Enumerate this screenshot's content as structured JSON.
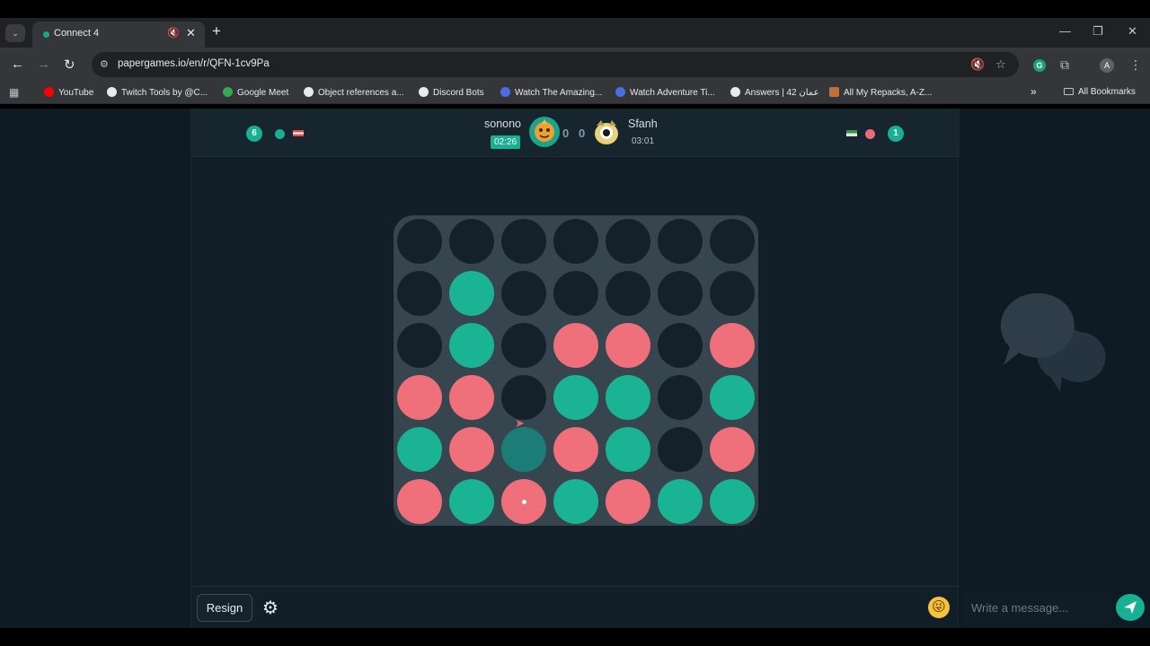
{
  "browser": {
    "tab_title": "Connect 4",
    "new_tab_glyph": "+",
    "tab_close_glyph": "✕",
    "tab_mute_glyph": "🔇",
    "url": "papergames.io/en/r/QFN-1cv9Pa",
    "back_glyph": "←",
    "forward_glyph": "→",
    "reload_glyph": "↻",
    "site_info_glyph": "⚙",
    "star_glyph": "☆",
    "extensions_glyph": "⧉",
    "menu_glyph": "⋮",
    "profile_initial": "A",
    "ext_g_letter": "G",
    "window_minimize": "—",
    "window_restore": "❐",
    "window_close": "✕",
    "tab_list_glyph": "⌄",
    "bookmarks": [
      {
        "label": "YouTube",
        "color": "#ff0000"
      },
      {
        "label": "Twitch Tools by @C...",
        "color": "#e8eaed"
      },
      {
        "label": "Google Meet",
        "color": "#34a853"
      },
      {
        "label": "Object references a...",
        "color": "#e8eaed"
      },
      {
        "label": "Discord Bots",
        "color": "#e8eaed"
      },
      {
        "label": "Watch The Amazing...",
        "color": "#4a6ee0"
      },
      {
        "label": "Watch Adventure Ti...",
        "color": "#4a6ee0"
      },
      {
        "label": "Answers | عمان 42",
        "color": "#e8eaed"
      },
      {
        "label": "All My Repacks, A-Z...",
        "color": "#c0703a"
      }
    ],
    "bookmarks_more": "»",
    "all_bookmarks": "All Bookmarks"
  },
  "game": {
    "left_count": "6",
    "right_count": "1",
    "player1": {
      "name": "sonono",
      "timer": "02:26",
      "score": "0",
      "color": "#17b092"
    },
    "player2": {
      "name": "Sfanh",
      "timer": "03:01",
      "score": "0",
      "color": "#ec6b78"
    },
    "colors": {
      "empty": "#14212b",
      "teal": "#1ab394",
      "red": "#ef6f7b",
      "hover": "#1c7d78",
      "board": "#37454f"
    },
    "board": [
      [
        "E",
        "E",
        "E",
        "E",
        "E",
        "E",
        "E"
      ],
      [
        "E",
        "T",
        "E",
        "E",
        "E",
        "E",
        "E"
      ],
      [
        "E",
        "T",
        "E",
        "R",
        "R",
        "E",
        "R"
      ],
      [
        "R",
        "R",
        "E",
        "T",
        "T",
        "E",
        "T"
      ],
      [
        "T",
        "R",
        "H",
        "R",
        "T",
        "E",
        "R"
      ],
      [
        "R",
        "T",
        "R",
        "T",
        "R",
        "T",
        "T"
      ]
    ],
    "last_move": {
      "row": 5,
      "col": 2
    }
  },
  "footer": {
    "resign_label": "Resign",
    "settings_glyph": "⚙",
    "emoji_glyph": "😜"
  },
  "chat": {
    "placeholder": "Write a message..."
  }
}
